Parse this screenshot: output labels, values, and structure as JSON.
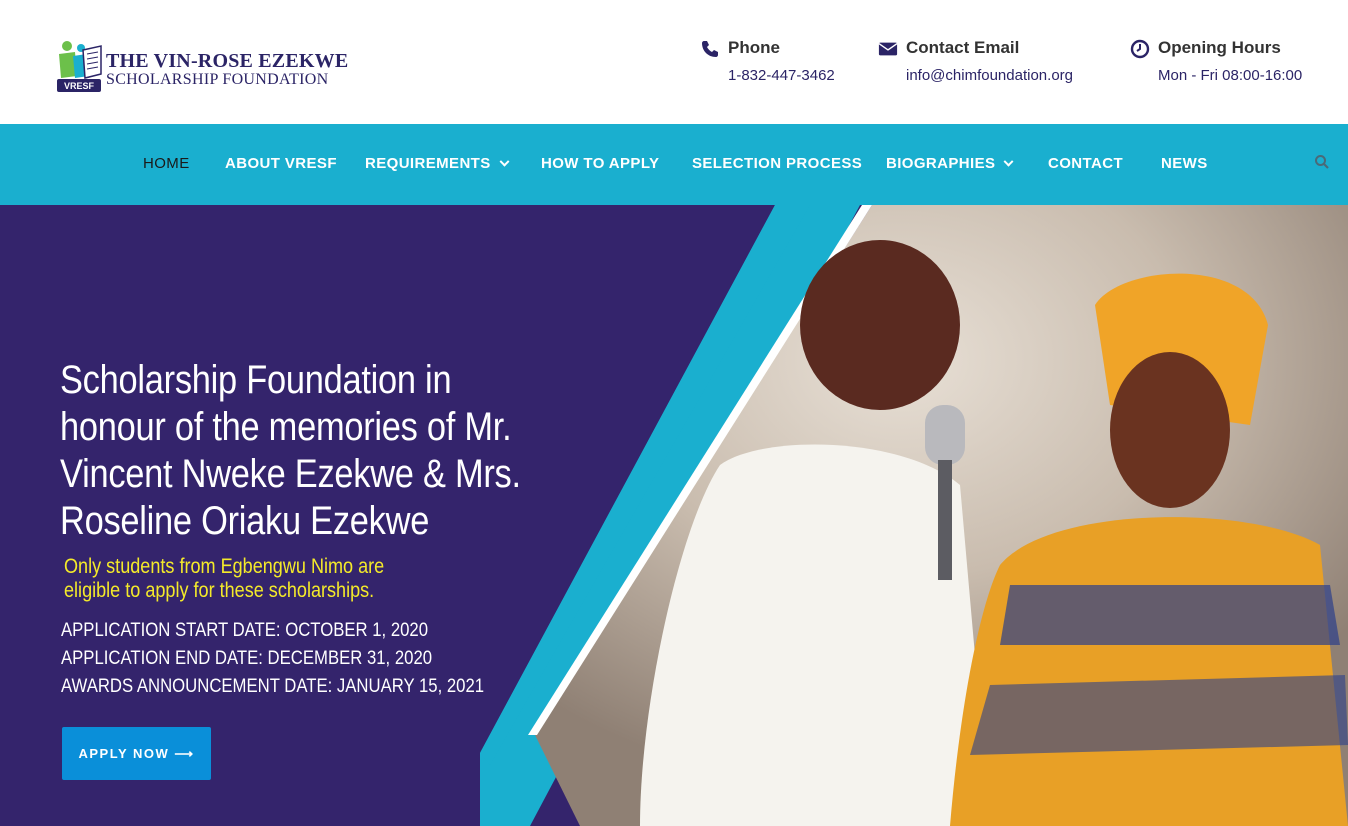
{
  "logo": {
    "line1": "THE VIN-ROSE EZEKWE",
    "line2": "SCHOLARSHIP FOUNDATION",
    "badge": "VRESF"
  },
  "contact": {
    "phone": {
      "title": "Phone",
      "value": "1-832-447-3462",
      "icon": "phone-icon"
    },
    "email": {
      "title": "Contact Email",
      "value": "info@chimfoundation.org",
      "icon": "envelope-icon"
    },
    "hours": {
      "title": "Opening Hours",
      "value": "Mon - Fri 08:00-16:00",
      "icon": "clock-icon"
    }
  },
  "nav": {
    "items": [
      {
        "label": "HOME"
      },
      {
        "label": "ABOUT VRESF"
      },
      {
        "label": "REQUIREMENTS"
      },
      {
        "label": "HOW TO APPLY"
      },
      {
        "label": "SELECTION PROCESS"
      },
      {
        "label": "BIOGRAPHIES"
      },
      {
        "label": "CONTACT"
      },
      {
        "label": "NEWS"
      }
    ]
  },
  "hero": {
    "title_lines": [
      "Scholarship Foundation in",
      "honour of the memories of Mr.",
      "Vincent Nweke Ezekwe & Mrs.",
      "Roseline Oriaku Ezekwe"
    ],
    "note_lines": [
      "Only students from Egbengwu Nimo are",
      "eligible to apply for these scholarships."
    ],
    "dates": [
      "APPLICATION START DATE: OCTOBER 1, 2020",
      "APPLICATION END DATE: DECEMBER 31, 2020",
      "AWARDS ANNOUNCEMENT DATE: JANUARY 15, 2021"
    ],
    "apply_label": "APPLY NOW ⟶"
  },
  "colors": {
    "nav_bg": "#1aafcf",
    "hero_bg": "#34246c",
    "brand_text": "#2b2466",
    "note_yellow": "#f4ea2a",
    "button_blue": "#0a8fd9"
  }
}
